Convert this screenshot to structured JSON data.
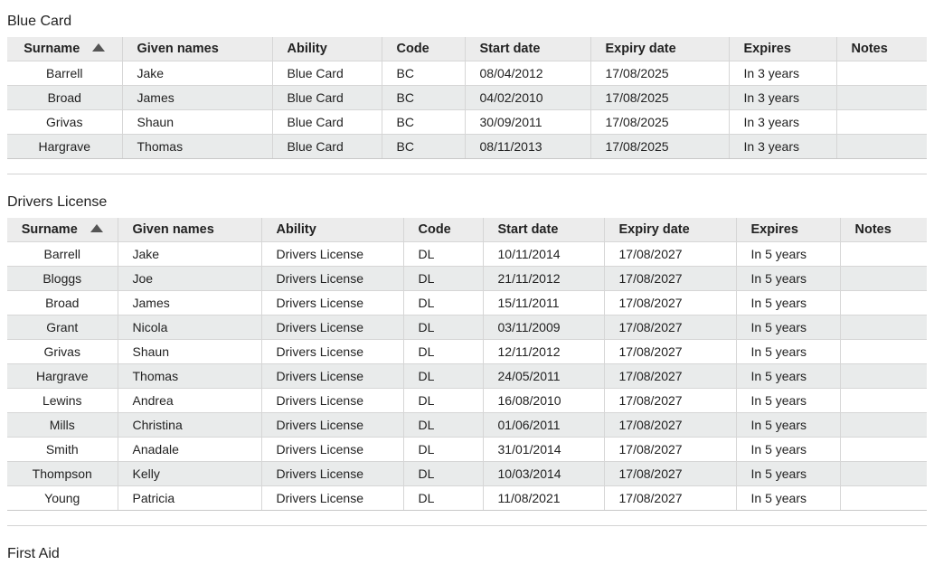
{
  "sections": [
    {
      "title": "Blue Card",
      "columns": [
        "Surname",
        "Given names",
        "Ability",
        "Code",
        "Start date",
        "Expiry date",
        "Expires",
        "Notes"
      ],
      "rows": [
        [
          "Barrell",
          "Jake",
          "Blue Card",
          "BC",
          "08/04/2012",
          "17/08/2025",
          "In 3 years",
          ""
        ],
        [
          "Broad",
          "James",
          "Blue Card",
          "BC",
          "04/02/2010",
          "17/08/2025",
          "In 3 years",
          ""
        ],
        [
          "Grivas",
          "Shaun",
          "Blue Card",
          "BC",
          "30/09/2011",
          "17/08/2025",
          "In 3 years",
          ""
        ],
        [
          "Hargrave",
          "Thomas",
          "Blue Card",
          "BC",
          "08/11/2013",
          "17/08/2025",
          "In 3 years",
          ""
        ]
      ]
    },
    {
      "title": "Drivers License",
      "columns": [
        "Surname",
        "Given names",
        "Ability",
        "Code",
        "Start date",
        "Expiry date",
        "Expires",
        "Notes"
      ],
      "rows": [
        [
          "Barrell",
          "Jake",
          "Drivers License",
          "DL",
          "10/11/2014",
          "17/08/2027",
          "In 5 years",
          ""
        ],
        [
          "Bloggs",
          "Joe",
          "Drivers License",
          "DL",
          "21/11/2012",
          "17/08/2027",
          "In 5 years",
          ""
        ],
        [
          "Broad",
          "James",
          "Drivers License",
          "DL",
          "15/11/2011",
          "17/08/2027",
          "In 5 years",
          ""
        ],
        [
          "Grant",
          "Nicola",
          "Drivers License",
          "DL",
          "03/11/2009",
          "17/08/2027",
          "In 5 years",
          ""
        ],
        [
          "Grivas",
          "Shaun",
          "Drivers License",
          "DL",
          "12/11/2012",
          "17/08/2027",
          "In 5 years",
          ""
        ],
        [
          "Hargrave",
          "Thomas",
          "Drivers License",
          "DL",
          "24/05/2011",
          "17/08/2027",
          "In 5 years",
          ""
        ],
        [
          "Lewins",
          "Andrea",
          "Drivers License",
          "DL",
          "16/08/2010",
          "17/08/2027",
          "In 5 years",
          ""
        ],
        [
          "Mills",
          "Christina",
          "Drivers License",
          "DL",
          "01/06/2011",
          "17/08/2027",
          "In 5 years",
          ""
        ],
        [
          "Smith",
          "Anadale",
          "Drivers License",
          "DL",
          "31/01/2014",
          "17/08/2027",
          "In 5 years",
          ""
        ],
        [
          "Thompson",
          "Kelly",
          "Drivers License",
          "DL",
          "10/03/2014",
          "17/08/2027",
          "In 5 years",
          ""
        ],
        [
          "Young",
          "Patricia",
          "Drivers License",
          "DL",
          "11/08/2021",
          "17/08/2027",
          "In 5 years",
          ""
        ]
      ]
    },
    {
      "title": "First Aid"
    }
  ],
  "sort": {
    "column": "Surname",
    "direction": "ascending",
    "icon": "sort-ascending-icon"
  },
  "colors": {
    "header_bg": "#ececec",
    "alt_row_bg": "#e9ebeb",
    "border": "#d6d6d6"
  }
}
